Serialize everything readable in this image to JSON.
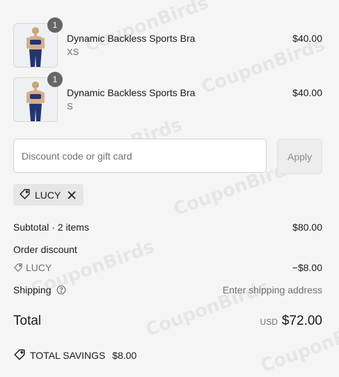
{
  "items": [
    {
      "title": "Dynamic Backless Sports Bra",
      "variant": "XS",
      "price": "$40.00",
      "quantity": "1"
    },
    {
      "title": "Dynamic Backless Sports Bra",
      "variant": "S",
      "price": "$40.00",
      "quantity": "1"
    }
  ],
  "discount": {
    "placeholder": "Discount code or gift card",
    "apply_label": "Apply",
    "applied_code": "LUCY"
  },
  "summary": {
    "subtotal_label": "Subtotal · 2 items",
    "subtotal_value": "$80.00",
    "order_discount_label": "Order discount",
    "discount_code": "LUCY",
    "discount_value": "−$8.00",
    "shipping_label": "Shipping",
    "shipping_value": "Enter shipping address",
    "total_label": "Total",
    "currency": "USD",
    "total_value": "$72.00",
    "savings_label": "TOTAL SAVINGS",
    "savings_value": "$8.00"
  },
  "watermark_text": "CouponBirds",
  "colors": {
    "background": "#f5f5f5",
    "badge": "#666666",
    "muted": "#707070"
  }
}
